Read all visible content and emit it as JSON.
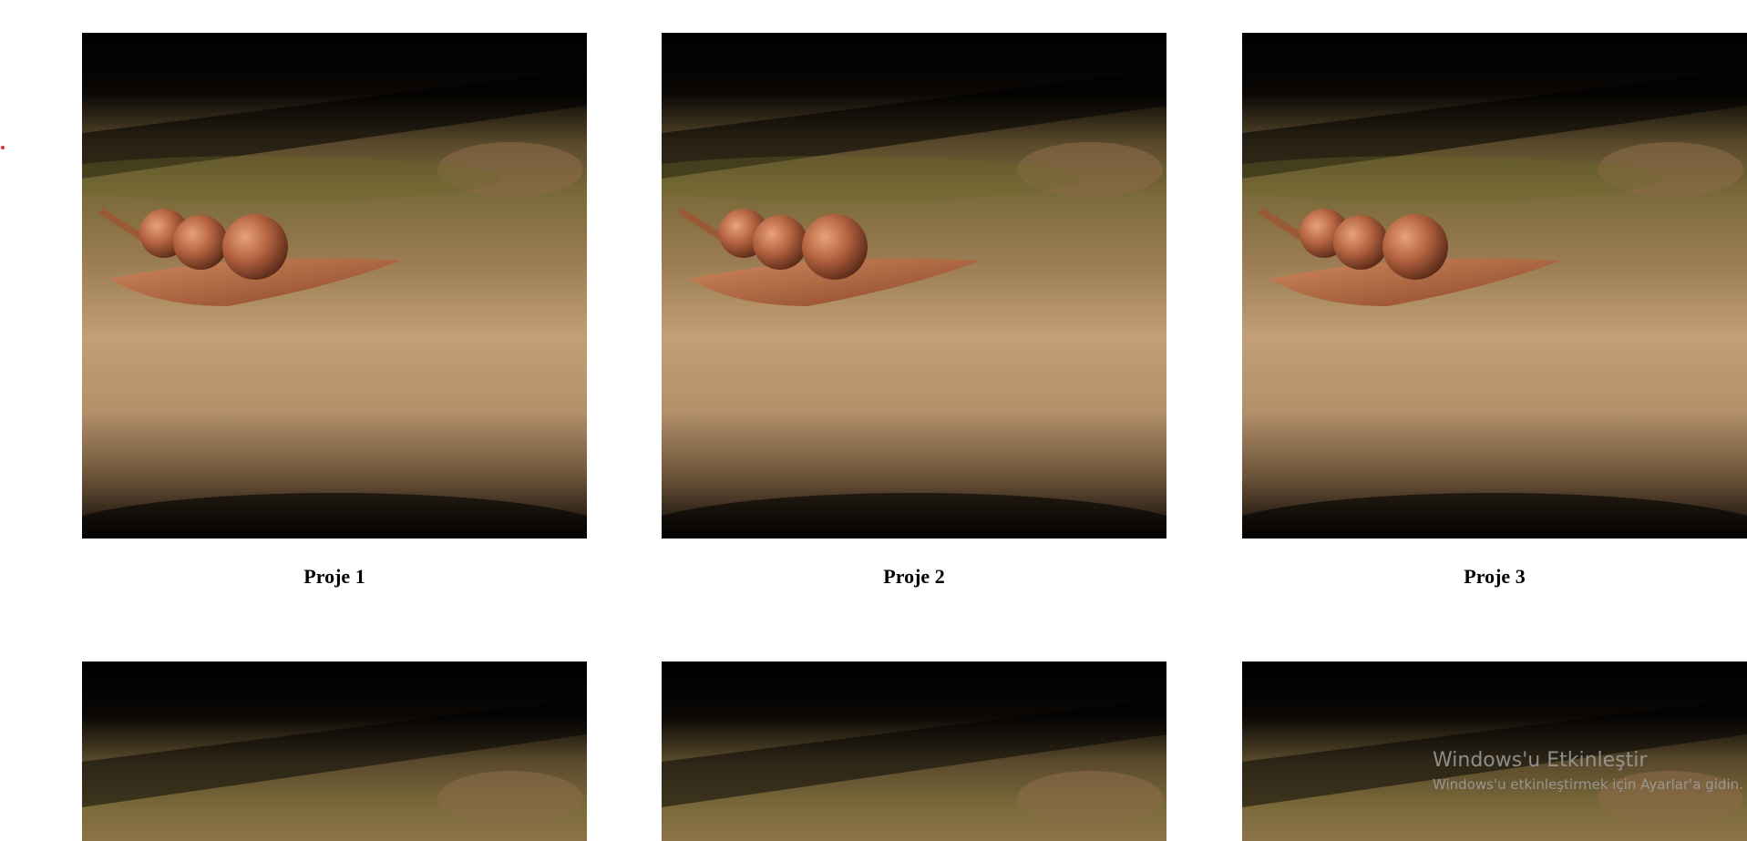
{
  "projects": [
    {
      "caption": "Proje 1"
    },
    {
      "caption": "Proje 2"
    },
    {
      "caption": "Proje 3"
    }
  ],
  "watermark": {
    "title": "Windows'u Etkinleştir",
    "subtitle": "Windows'u etkinleştirmek için Ayarlar'a gidin."
  },
  "colors": {
    "accent_dot": "#e03030"
  },
  "image_icon": "leaf-with-berries-photo"
}
